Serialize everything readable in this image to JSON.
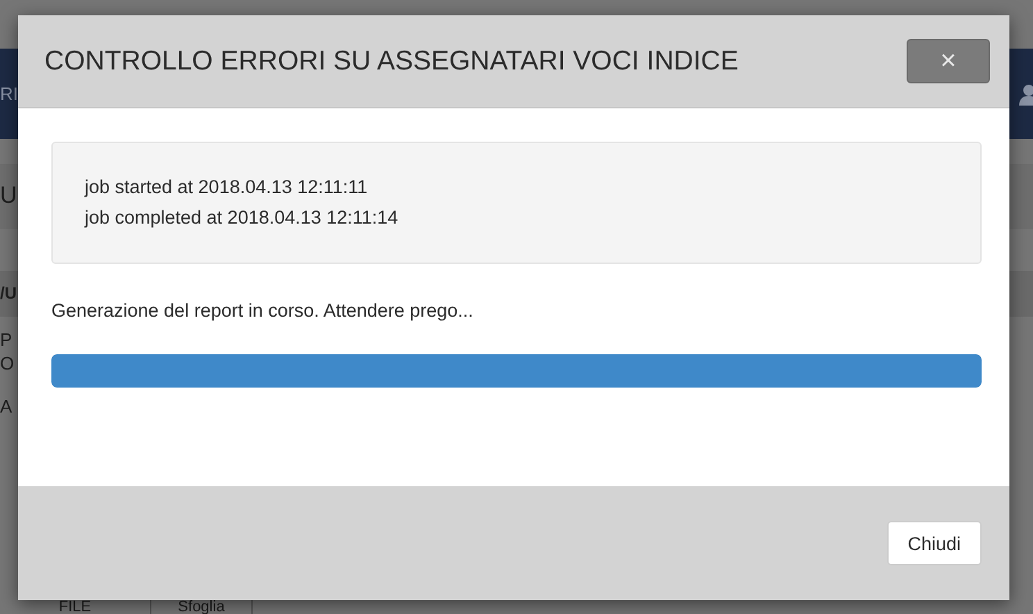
{
  "background_page": {
    "header_text": "RI",
    "section_title": "U",
    "subsection_title": "/U",
    "lines": [
      "P",
      "O"
    ],
    "label": "A",
    "file_label": "FILE",
    "browse_button": "Sfoglia"
  },
  "dialog": {
    "title": "CONTROLLO ERRORI SU ASSEGNATARI VOCI INDICE",
    "close_button": "×",
    "log": [
      "job started at 2018.04.13 12:11:11",
      "job completed at 2018.04.13 12:11:14"
    ],
    "status": "Generazione del report in corso. Attendere prego...",
    "progress": {
      "level": 1
    },
    "buttons": [
      "Chiudi"
    ]
  }
}
